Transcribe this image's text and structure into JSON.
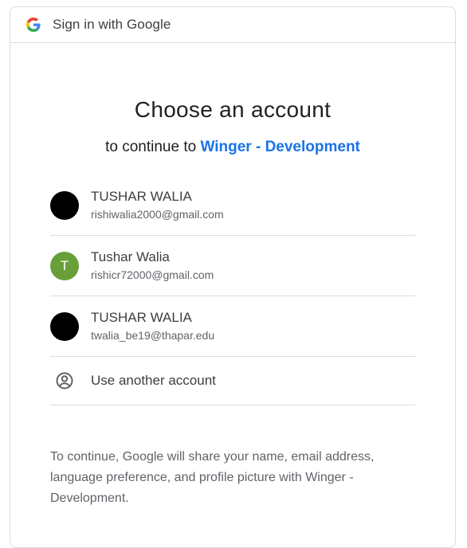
{
  "header": {
    "title": "Sign in with Google",
    "logo_icon": "google-g-icon"
  },
  "main": {
    "title": "Choose an account",
    "subtitle_prefix": "to continue to ",
    "app_name": "Winger - Development"
  },
  "accounts": [
    {
      "name": "TUSHAR WALIA",
      "email": "rishiwalia2000@gmail.com",
      "avatar_initial": "",
      "avatar_color": "#000000"
    },
    {
      "name": "Tushar Walia",
      "email": "rishicr72000@gmail.com",
      "avatar_initial": "T",
      "avatar_color": "#689f38"
    },
    {
      "name": "TUSHAR WALIA",
      "email": "twalia_be19@thapar.edu",
      "avatar_initial": "",
      "avatar_color": "#000000"
    }
  ],
  "use_another": {
    "label": "Use another account",
    "icon": "account-circle-icon"
  },
  "disclaimer": "To continue, Google will share your name, email address, language preference, and profile picture with Winger - Development.",
  "colors": {
    "link_blue": "#1a73e8",
    "border": "#dadce0",
    "text_primary": "#202124",
    "text_secondary": "#5f6368"
  }
}
